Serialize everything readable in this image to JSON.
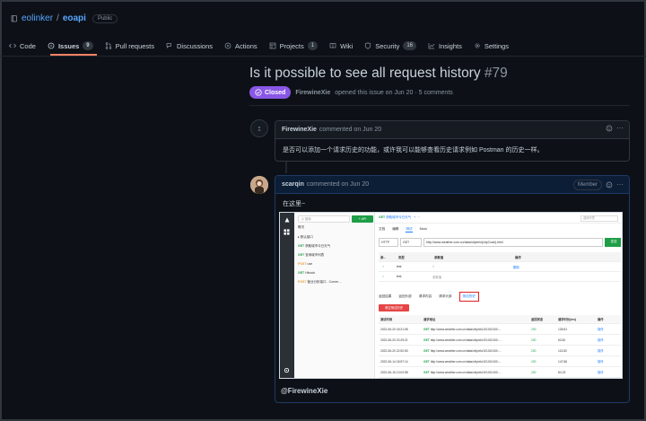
{
  "repo": {
    "owner": "eolinker",
    "name": "eoapi",
    "visibility": "Public"
  },
  "nav": [
    {
      "key": "code",
      "label": "Code",
      "icon": "code-icon"
    },
    {
      "key": "issues",
      "label": "Issues",
      "count": "9",
      "icon": "issue-icon",
      "active": true
    },
    {
      "key": "pulls",
      "label": "Pull requests",
      "icon": "pull-request-icon"
    },
    {
      "key": "discussions",
      "label": "Discussions",
      "icon": "discussion-icon"
    },
    {
      "key": "actions",
      "label": "Actions",
      "icon": "play-icon"
    },
    {
      "key": "projects",
      "label": "Projects",
      "count": "1",
      "icon": "table-icon"
    },
    {
      "key": "wiki",
      "label": "Wiki",
      "icon": "book-icon"
    },
    {
      "key": "security",
      "label": "Security",
      "count": "16",
      "icon": "shield-icon"
    },
    {
      "key": "insights",
      "label": "Insights",
      "icon": "graph-icon"
    },
    {
      "key": "settings",
      "label": "Settings",
      "icon": "gear-icon"
    }
  ],
  "issue": {
    "title": "Is it possible to see all request history",
    "number": "#79",
    "state": "Closed",
    "author": "FirewineXie",
    "meta": "opened this issue on Jun 20 · 5 comments"
  },
  "comments": [
    {
      "author": "FirewineXie",
      "meta": "commented on Jun 20",
      "body": "是否可以添加一个请求历史的功能，或许我可以能够查看历史请求例如 Postman 的历史一样。"
    },
    {
      "author": "scarqin",
      "meta": "commented on Jun 20",
      "role": "Member",
      "body": "在这里~",
      "mention": "@FirewineXie"
    }
  ],
  "screenshot": {
    "search_placeholder": "Q 搜索",
    "add_api": "+ API",
    "sidebar": [
      {
        "label": "概况",
        "type": ""
      },
      {
        "label": "▸ 默认接口",
        "type": ""
      },
      {
        "label": "获取城市今日天气",
        "type": "GET"
      },
      {
        "label": "查询城市列表",
        "type": "GET"
      },
      {
        "label": "use",
        "type": "POST"
      },
      {
        "label": "Hibook",
        "type": "GET"
      },
      {
        "label": "营业分析接口 - Conne...",
        "type": "POST"
      }
    ],
    "tab_label": "获取城市今日天气",
    "env_placeholder": "选择环境",
    "subtabs": [
      "文档",
      "编辑",
      "测试",
      "Mock"
    ],
    "active_subtab": "测试",
    "protocol": "HTTP",
    "method": "GET",
    "url": "http://www.weather.com.cn/data/cityinfo/{cityCode}.html",
    "send": "发送",
    "param_headers": [
      "参...",
      "类型",
      "参数值",
      "操作"
    ],
    "params": [
      {
        "name": "test",
        "value": "1",
        "op": "删除"
      },
      {
        "name": "test",
        "value": "参数值",
        "op": ""
      }
    ],
    "response_tabs": [
      "返回结果",
      "返回头部",
      "请求内容",
      "请求头部",
      "测试历史"
    ],
    "highlighted_tab": "测试历史",
    "clear_button": "清空测试历史",
    "history_headers": [
      "测试时间",
      "请求地址",
      "返回状态",
      "请求时长(ms)",
      "操作"
    ],
    "history": [
      {
        "time": "2022-06-20 18:21:08",
        "url": "http://www.weather.com.cn/data/cityinfo/101010100....",
        "status": "200",
        "duration": "128.81",
        "op": "操作"
      },
      {
        "time": "2022-06-20 20:29:21",
        "url": "http://www.weather.com.cn/data/cityinfo/101010100....",
        "status": "200",
        "duration": "63.81",
        "op": "操作"
      },
      {
        "time": "2022-06-20 22:52:53",
        "url": "http://www.weather.com.cn/data/cityinfo/101010100....",
        "status": "200",
        "duration": "113.80",
        "op": "操作"
      },
      {
        "time": "2022-06-14 18:57:14",
        "url": "http://www.weather.com.cn/data/cityinfo/101010100....",
        "status": "200",
        "duration": "147.86",
        "op": "操作"
      },
      {
        "time": "2022-06-15 13:02:58",
        "url": "http://www.weather.com.cn/data/cityinfo/101010100....",
        "status": "200",
        "duration": "84.23",
        "op": "操作"
      }
    ]
  },
  "colors": {
    "bg": "#0d1117",
    "closed": "#8957e5",
    "link": "#58a6ff",
    "accent": "#f78166",
    "green": "#1e9e46"
  }
}
